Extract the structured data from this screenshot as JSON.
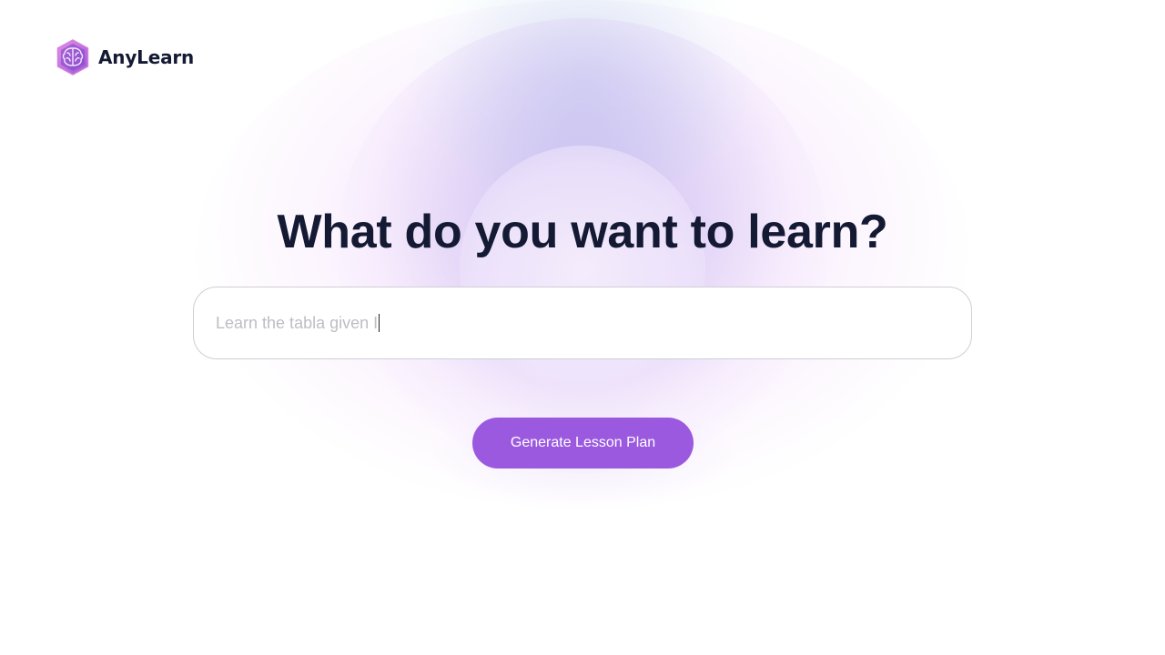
{
  "brand": {
    "name": "AnyLearn",
    "logo_icon": "brain-hexagon-icon"
  },
  "hero": {
    "heading": "What do you want to learn?"
  },
  "search": {
    "value": "Learn the tabla given I",
    "state": "focused-typing"
  },
  "actions": {
    "generate_label": "Generate Lesson Plan"
  },
  "colors": {
    "accent": "#9b59e0",
    "heading": "#141a33",
    "input_text": "#bdbdc4"
  }
}
